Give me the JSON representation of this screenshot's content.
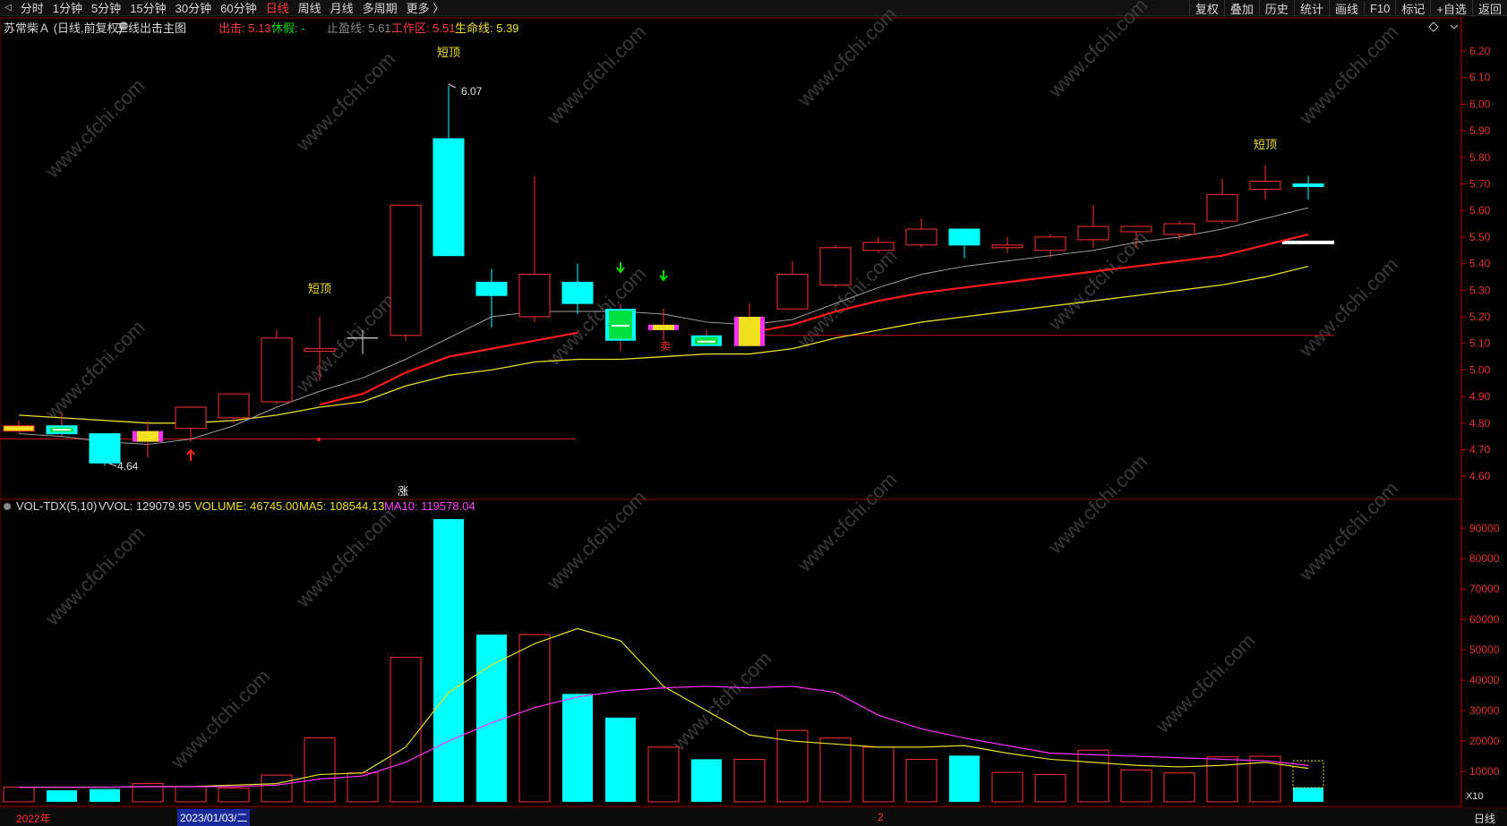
{
  "toolbar": {
    "left_icon": "collapse-icon",
    "periods": [
      "分时",
      "1分钟",
      "5分钟",
      "15分钟",
      "30分钟",
      "60分钟",
      "日线",
      "周线",
      "月线",
      "多周期",
      "更多 〉"
    ],
    "active_period": "日线",
    "right_items": [
      "复权",
      "叠加",
      "历史",
      "统计",
      "画线",
      "F10",
      "标记",
      "+自选",
      "返回"
    ]
  },
  "main_header": {
    "stock": "苏常柴Ａ (日线,前复权)",
    "indicator": "三线出击主图",
    "exit_label": "出击: 5.13",
    "rest_label": "休假: -",
    "stop_label": "止盈线: 5.61",
    "work_label": "工作区: 5.51",
    "life_label": "生命线: 5.39"
  },
  "vol_header": {
    "name": "VOL-TDX(5,10)",
    "vvol": "VVOL: 129079.95",
    "volume": "VOLUME: 46745.00",
    "ma5": "MA5: 108544.13",
    "ma10": "MA10: 119578.04"
  },
  "annotations": {
    "top_short_1": "短顶",
    "top_short_2": "短顶",
    "top_short_3": "短顶",
    "high_label": "6.07",
    "low_label": "4.64",
    "zhang": "涨",
    "mai": "卖"
  },
  "price_axis": [
    "6.20",
    "6.10",
    "6.00",
    "5.90",
    "5.80",
    "5.70",
    "5.60",
    "5.50",
    "5.40",
    "5.30",
    "5.20",
    "5.10",
    "5.00",
    "4.90",
    "4.80",
    "4.70",
    "4.60"
  ],
  "vol_axis": [
    "90000",
    "80000",
    "70000",
    "60000",
    "50000",
    "40000",
    "30000",
    "20000",
    "10000"
  ],
  "vol_unit": "X10",
  "bottom": {
    "year": "2022年",
    "date": "2023/01/03/二",
    "mark": "2",
    "period": "日线"
  },
  "watermark": "www.cfchi.com",
  "colors": {
    "up": "#ff3030",
    "down": "#00ffff",
    "bg": "#000000",
    "axis": "#c00000"
  },
  "chart_data": {
    "type": "candlestick",
    "candles": [
      {
        "o": 4.79,
        "c": 4.77,
        "h": 4.81,
        "l": 4.76,
        "s": "y"
      },
      {
        "o": 4.79,
        "c": 4.76,
        "h": 4.84,
        "l": 4.75,
        "s": "gw"
      },
      {
        "o": 4.76,
        "c": 4.65,
        "h": 4.76,
        "l": 4.64,
        "s": "c"
      },
      {
        "o": 4.73,
        "c": 4.77,
        "h": 4.81,
        "l": 4.67,
        "s": "ym"
      },
      {
        "o": 4.78,
        "c": 4.86,
        "h": 4.86,
        "l": 4.73,
        "s": "u"
      },
      {
        "o": 4.82,
        "c": 4.91,
        "h": 4.91,
        "l": 4.8,
        "s": "u"
      },
      {
        "o": 4.88,
        "c": 5.12,
        "h": 5.15,
        "l": 4.87,
        "s": "u"
      },
      {
        "o": 5.07,
        "c": 5.08,
        "h": 5.2,
        "l": 4.96,
        "s": "u"
      },
      {
        "o": 5.12,
        "c": 5.12,
        "h": 5.15,
        "l": 5.06,
        "s": "w"
      },
      {
        "o": 5.13,
        "c": 5.62,
        "h": 5.62,
        "l": 5.11,
        "s": "u"
      },
      {
        "o": 5.87,
        "c": 5.43,
        "h": 6.07,
        "l": 5.43,
        "s": "c"
      },
      {
        "o": 5.33,
        "c": 5.28,
        "h": 5.38,
        "l": 5.16,
        "s": "c"
      },
      {
        "o": 5.2,
        "c": 5.36,
        "h": 5.73,
        "l": 5.18,
        "s": "u"
      },
      {
        "o": 5.33,
        "c": 5.25,
        "h": 5.4,
        "l": 5.21,
        "s": "c"
      },
      {
        "o": 5.23,
        "c": 5.11,
        "h": 5.25,
        "l": 5.07,
        "s": "cg"
      },
      {
        "o": 5.17,
        "c": 5.15,
        "h": 5.23,
        "l": 5.11,
        "s": "ym"
      },
      {
        "o": 5.13,
        "c": 5.09,
        "h": 5.15,
        "l": 5.09,
        "s": "cg"
      },
      {
        "o": 5.09,
        "c": 5.2,
        "h": 5.25,
        "l": 5.09,
        "s": "ym"
      },
      {
        "o": 5.23,
        "c": 5.36,
        "h": 5.41,
        "l": 5.23,
        "s": "u"
      },
      {
        "o": 5.32,
        "c": 5.46,
        "h": 5.47,
        "l": 5.31,
        "s": "u"
      },
      {
        "o": 5.45,
        "c": 5.48,
        "h": 5.5,
        "l": 5.44,
        "s": "u"
      },
      {
        "o": 5.47,
        "c": 5.53,
        "h": 5.57,
        "l": 5.46,
        "s": "u"
      },
      {
        "o": 5.53,
        "c": 5.47,
        "h": 5.53,
        "l": 5.42,
        "s": "c"
      },
      {
        "o": 5.46,
        "c": 5.47,
        "h": 5.5,
        "l": 5.44,
        "s": "u"
      },
      {
        "o": 5.45,
        "c": 5.5,
        "h": 5.51,
        "l": 5.42,
        "s": "u"
      },
      {
        "o": 5.49,
        "c": 5.54,
        "h": 5.62,
        "l": 5.46,
        "s": "u"
      },
      {
        "o": 5.52,
        "c": 5.54,
        "h": 5.54,
        "l": 5.46,
        "s": "u"
      },
      {
        "o": 5.51,
        "c": 5.55,
        "h": 5.56,
        "l": 5.49,
        "s": "u"
      },
      {
        "o": 5.56,
        "c": 5.66,
        "h": 5.72,
        "l": 5.55,
        "s": "u"
      },
      {
        "o": 5.68,
        "c": 5.71,
        "h": 5.77,
        "l": 5.64,
        "s": "u"
      },
      {
        "o": 5.7,
        "c": 5.69,
        "h": 5.73,
        "l": 5.64,
        "s": "c"
      }
    ],
    "ma_white": [
      4.76,
      4.75,
      4.73,
      4.72,
      4.74,
      4.79,
      4.86,
      4.92,
      4.97,
      5.04,
      5.12,
      5.2,
      5.22,
      5.22,
      5.22,
      5.21,
      5.18,
      5.17,
      5.19,
      5.25,
      5.31,
      5.36,
      5.39,
      5.41,
      5.43,
      5.45,
      5.48,
      5.5,
      5.53,
      5.57,
      5.61
    ],
    "ma_red": [
      null,
      null,
      null,
      null,
      null,
      null,
      null,
      4.87,
      4.91,
      4.99,
      5.05,
      5.08,
      5.11,
      5.14,
      null,
      null,
      null,
      5.14,
      5.17,
      5.22,
      5.26,
      5.29,
      5.31,
      5.33,
      5.35,
      5.37,
      5.39,
      5.41,
      5.43,
      5.47,
      5.51
    ],
    "ma_yellow": [
      4.83,
      4.82,
      4.81,
      4.8,
      4.8,
      4.81,
      4.83,
      4.86,
      4.88,
      4.94,
      4.98,
      5.0,
      5.03,
      5.04,
      5.04,
      5.05,
      5.06,
      5.06,
      5.08,
      5.12,
      5.15,
      5.18,
      5.2,
      5.22,
      5.24,
      5.26,
      5.28,
      5.3,
      5.32,
      5.35,
      5.39
    ],
    "exit_line": 5.13,
    "support_line": 4.74,
    "volume": [
      {
        "v": 4800,
        "s": "u"
      },
      {
        "v": 3800,
        "s": "c"
      },
      {
        "v": 4200,
        "s": "c"
      },
      {
        "v": 6000,
        "s": "u"
      },
      {
        "v": 5000,
        "s": "u"
      },
      {
        "v": 4500,
        "s": "u"
      },
      {
        "v": 8800,
        "s": "u"
      },
      {
        "v": 21000,
        "s": "u"
      },
      {
        "v": 9500,
        "s": "u"
      },
      {
        "v": 47500,
        "s": "u"
      },
      {
        "v": 93000,
        "s": "c"
      },
      {
        "v": 55000,
        "s": "c"
      },
      {
        "v": 55000,
        "s": "u"
      },
      {
        "v": 35500,
        "s": "c"
      },
      {
        "v": 27700,
        "s": "c"
      },
      {
        "v": 18000,
        "s": "u"
      },
      {
        "v": 14000,
        "s": "c"
      },
      {
        "v": 14000,
        "s": "u"
      },
      {
        "v": 23500,
        "s": "u"
      },
      {
        "v": 21000,
        "s": "u"
      },
      {
        "v": 18000,
        "s": "u"
      },
      {
        "v": 14000,
        "s": "u"
      },
      {
        "v": 15200,
        "s": "c"
      },
      {
        "v": 9700,
        "s": "u"
      },
      {
        "v": 9000,
        "s": "u"
      },
      {
        "v": 17000,
        "s": "u"
      },
      {
        "v": 10500,
        "s": "u"
      },
      {
        "v": 9500,
        "s": "u"
      },
      {
        "v": 14800,
        "s": "u"
      },
      {
        "v": 15000,
        "s": "u"
      },
      {
        "v": 4674,
        "s": "c"
      }
    ],
    "vol_ma5": [
      4800,
      4800,
      4800,
      5000,
      5000,
      5500,
      6000,
      9000,
      9500,
      18000,
      36000,
      45000,
      52000,
      57000,
      53000,
      38000,
      30000,
      22000,
      20000,
      19000,
      18000,
      18000,
      18500,
      16000,
      14000,
      13000,
      12000,
      11500,
      12000,
      13000,
      11000
    ],
    "vol_ma10": [
      4800,
      4800,
      4800,
      5000,
      5000,
      5000,
      5500,
      7500,
      8500,
      13000,
      20000,
      26000,
      31000,
      34500,
      36500,
      37500,
      38000,
      37500,
      38000,
      36000,
      28500,
      24000,
      21000,
      18500,
      16000,
      15500,
      15000,
      14500,
      14000,
      13500,
      12000
    ]
  }
}
